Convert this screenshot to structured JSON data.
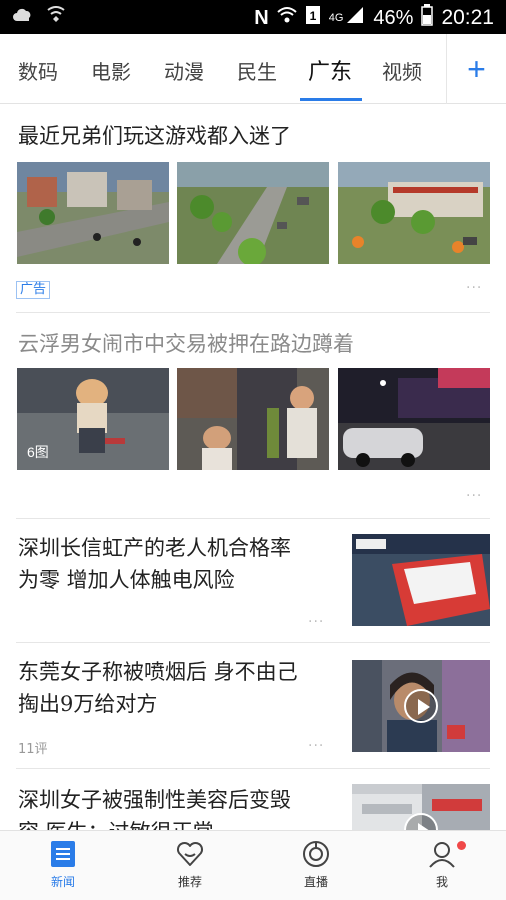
{
  "status_bar": {
    "battery_percent": "46%",
    "time": "20:21",
    "network": "4G",
    "icons": [
      "weather-icon",
      "shield-icon",
      "n-icon",
      "wifi-icon",
      "sim-icon",
      "signal-icon",
      "battery-icon"
    ]
  },
  "tabs": {
    "items": [
      {
        "label": "数码"
      },
      {
        "label": "电影"
      },
      {
        "label": "动漫"
      },
      {
        "label": "民生"
      },
      {
        "label": "广东",
        "active": true
      },
      {
        "label": "视频"
      }
    ],
    "add_label": "+",
    "accent_color": "#2a7ce8"
  },
  "feed": {
    "articles": [
      {
        "title": "最近兄弟们玩这游戏都入迷了",
        "ad_label": "广告",
        "more": "···",
        "images": [
          "game-screenshot-1",
          "game-screenshot-2",
          "game-screenshot-3"
        ]
      },
      {
        "title": "云浮男女闹市中交易被押在路边蹲着",
        "read": true,
        "image_count": "6图",
        "more": "···",
        "images": [
          "photo-girl",
          "photo-street-people",
          "photo-night-street"
        ]
      },
      {
        "title_line1": "深圳长信虹产的老人机合格率",
        "title_line2": "为零 增加人体触电风险",
        "more": "···",
        "image": "phone-photo"
      },
      {
        "title_line1": "东莞女子称被喷烟后 身不由己",
        "title_line2": "掏出9万给对方",
        "comments": "11评",
        "more": "···",
        "image": "video-woman",
        "is_video": true
      },
      {
        "title_line1": "深圳女子被强制性美容后变毁",
        "title_line2": "容 医生：过敏很正常",
        "image": "video-street",
        "is_video": true
      }
    ]
  },
  "bottom_nav": {
    "items": [
      {
        "label": "新闻",
        "icon": "news-icon",
        "active": true
      },
      {
        "label": "推荐",
        "icon": "heart-icon"
      },
      {
        "label": "直播",
        "icon": "live-icon"
      },
      {
        "label": "我",
        "icon": "profile-icon",
        "badge": true
      }
    ]
  }
}
